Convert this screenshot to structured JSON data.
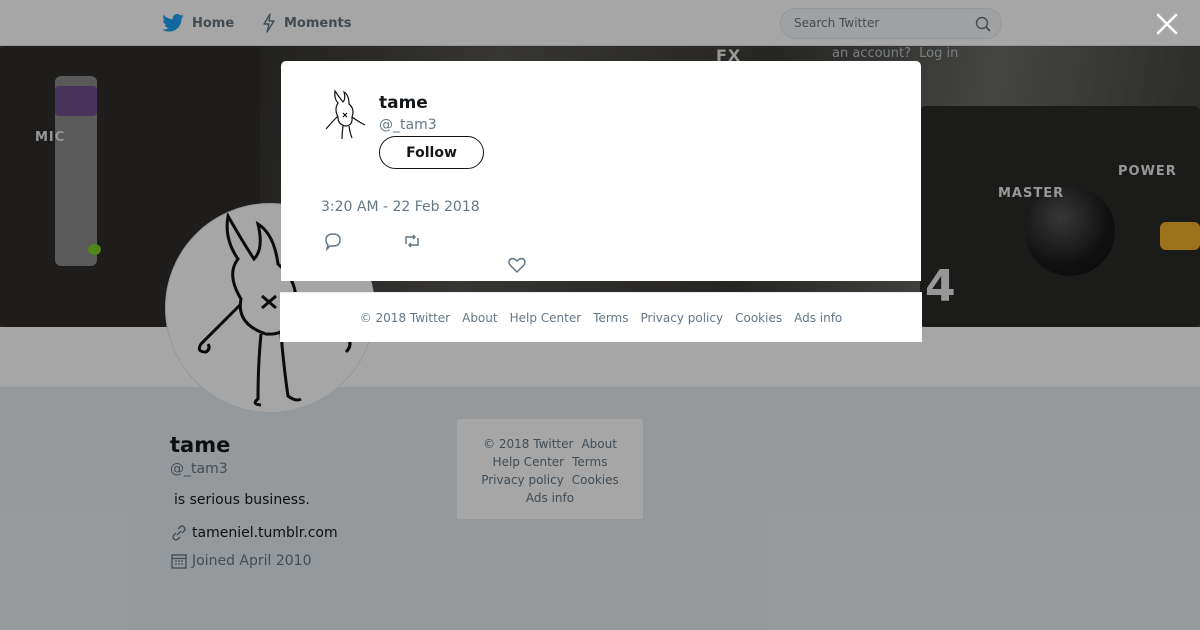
{
  "nav": {
    "home_label": "Home",
    "moments_label": "Moments",
    "search_placeholder": "Search Twitter"
  },
  "banner_overlay": {
    "text": "an account?",
    "login": "Log in"
  },
  "profile": {
    "name": "tame",
    "handle": "@_tam3",
    "bio": " is serious business.",
    "url": "tameniel.tumblr.com",
    "joined": "Joined April 2010"
  },
  "sidebar_footer": {
    "copyright": "© 2018 Twitter",
    "about": "About",
    "help": "Help Center",
    "terms": "Terms",
    "privacy": "Privacy policy",
    "cookies": "Cookies",
    "ads": "Ads info"
  },
  "tweet": {
    "name": "tame",
    "handle": "@_tam3",
    "follow_label": "Follow",
    "text": "",
    "timestamp": "3:20 AM - 22 Feb 2018"
  },
  "modal_footer": {
    "copyright": "© 2018 Twitter",
    "about": "About",
    "help": "Help Center",
    "terms": "Terms",
    "privacy": "Privacy policy",
    "cookies": "Cookies",
    "ads": "Ads info"
  },
  "colors": {
    "brand_blue": "#1da1f2",
    "text_dark": "#14171a",
    "text_gray": "#657786"
  }
}
